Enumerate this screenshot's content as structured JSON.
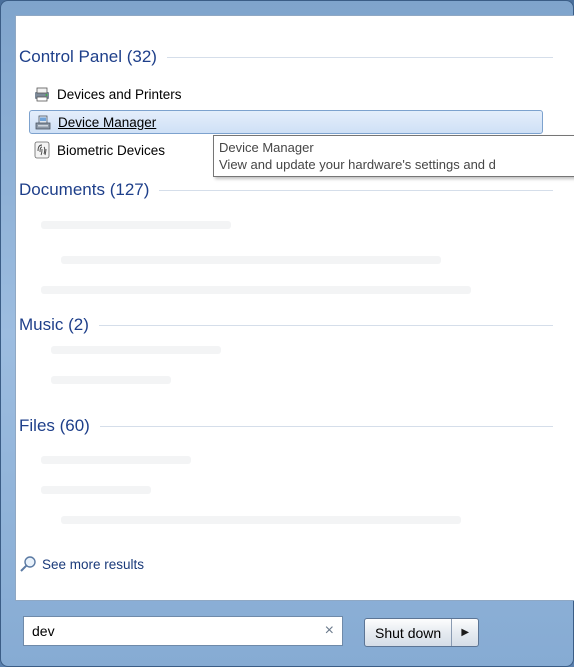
{
  "groups": {
    "control_panel": "Control Panel (32)",
    "documents": "Documents (127)",
    "music": "Music (2)",
    "files": "Files (60)"
  },
  "results": [
    {
      "label": "Devices and Printers",
      "icon": "printer-icon"
    },
    {
      "label": "Device Manager",
      "icon": "device-manager-icon"
    },
    {
      "label": "Biometric Devices",
      "icon": "fingerprint-icon"
    }
  ],
  "tooltip": {
    "title": "Device Manager",
    "desc": "View and update your hardware's settings and d"
  },
  "see_more": "See more results",
  "search": {
    "value": "dev",
    "clear": "×"
  },
  "shutdown": {
    "label": "Shut down",
    "arrow": "▶"
  }
}
